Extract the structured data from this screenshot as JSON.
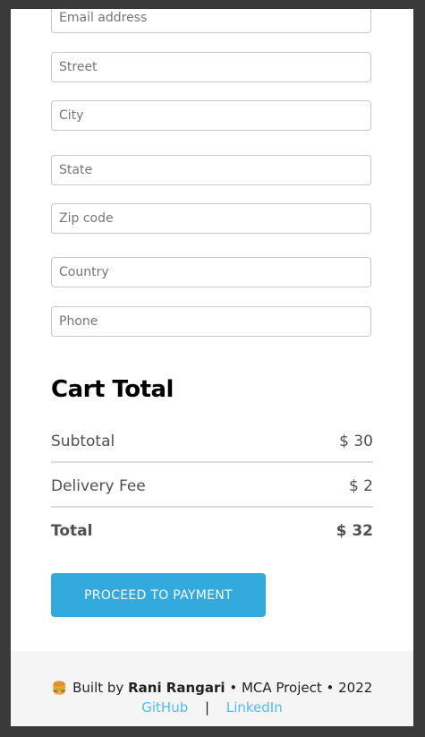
{
  "form": {
    "email_placeholder": "Email address",
    "street_placeholder": "Street",
    "city_placeholder": "City",
    "state_placeholder": "State",
    "zip_placeholder": "Zip code",
    "country_placeholder": "Country",
    "phone_placeholder": "Phone"
  },
  "cart": {
    "title": "Cart Total",
    "subtotal_label": "Subtotal",
    "subtotal_value": "$ 30",
    "delivery_label": "Delivery Fee",
    "delivery_value": "$ 2",
    "total_label": "Total",
    "total_value": "$ 32",
    "proceed_label": "PROCEED TO PAYMENT"
  },
  "footer": {
    "icon": "hamburger-icon",
    "built_by": "Built by",
    "author": "Rani Rangari",
    "project": "• MCA Project • 2022",
    "separator": "|",
    "github": "GitHub",
    "linkedin": "LinkedIn"
  },
  "colors": {
    "accent": "#33aadd",
    "link": "#55bbee",
    "footer_bg": "#f5f5f5"
  }
}
